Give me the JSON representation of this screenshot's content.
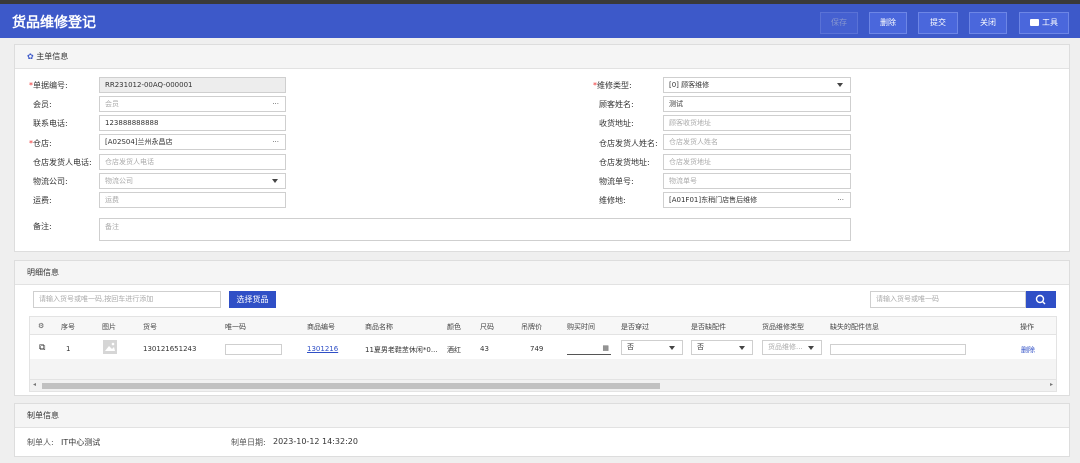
{
  "header": {
    "title": "货品维修登记",
    "buttons": {
      "save": "保存",
      "delete": "删除",
      "submit": "提交",
      "close": "关闭",
      "tools": "工具"
    }
  },
  "main_info": {
    "section_title": "主单信息",
    "doc_no": {
      "label": "单据编号:",
      "value": "RR231012-00AQ-000001"
    },
    "member": {
      "label": "会员:",
      "placeholder": "会员"
    },
    "phone": {
      "label": "联系电话:",
      "value": "123888888888"
    },
    "warehouse": {
      "label": "仓店:",
      "value": "[A02S04]兰州永昌店"
    },
    "wh_phone": {
      "label": "仓店发货人电话:",
      "placeholder": "仓店发货人电话"
    },
    "logistics": {
      "label": "物流公司:",
      "placeholder": "物流公司"
    },
    "freight": {
      "label": "运费:",
      "placeholder": "运费"
    },
    "remark": {
      "label": "备注:",
      "placeholder": "备注"
    },
    "repair_type": {
      "label": "维修类型:",
      "value": "[0] 顾客维修"
    },
    "customer_name": {
      "label": "顾客姓名:",
      "value": "测试"
    },
    "address": {
      "label": "收货地址:",
      "placeholder": "顾客收货地址"
    },
    "wh_sender": {
      "label": "仓店发货人姓名:",
      "placeholder": "仓店发货人姓名"
    },
    "wh_address": {
      "label": "仓店发货地址:",
      "placeholder": "仓店发货地址"
    },
    "tracking": {
      "label": "物流单号:",
      "placeholder": "物流单号"
    },
    "repair_site": {
      "label": "维修地:",
      "value": "[A01F01]东稍门店售后维修"
    }
  },
  "detail": {
    "section_title": "明细信息",
    "scan_placeholder": "请输入货号或唯一码,按回车进行添加",
    "select_button": "选择货品",
    "search_placeholder": "请输入货号或唯一码",
    "columns": [
      "序号",
      "图片",
      "货号",
      "唯一码",
      "商品编号",
      "商品名称",
      "颜色",
      "尺码",
      "吊牌价",
      "购买时间",
      "是否穿过",
      "是否缺配件",
      "货品维修类型",
      "缺失的配件信息",
      "操作"
    ],
    "rows": [
      {
        "seq": "1",
        "sku": "130121651243",
        "unique": "",
        "code": "1301216",
        "name": "11夏男老鞋苤休闲*0...",
        "color": "酒红",
        "size": "43",
        "price": "749",
        "purchase": "",
        "worn": "否",
        "missing": "否",
        "repair_type": "货品维修...",
        "missing_info": "",
        "action": "删除"
      }
    ]
  },
  "make": {
    "section_title": "制单信息",
    "maker_label": "制单人:",
    "maker": "IT中心测试",
    "date_label": "制单日期:",
    "date": "2023-10-12 14:32:20"
  }
}
